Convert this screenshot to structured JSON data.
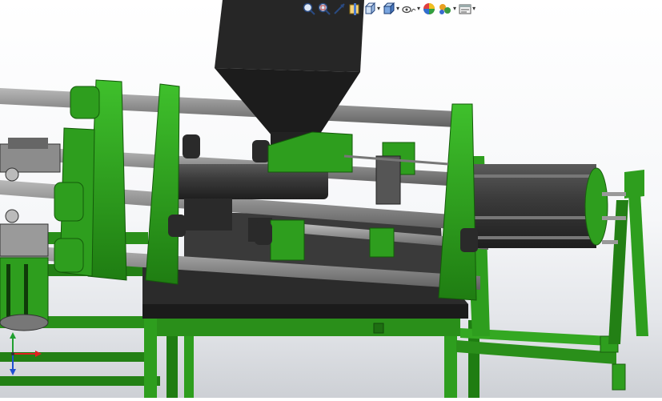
{
  "app": {
    "view": "3d-model-viewport",
    "part_color": "#2e9e1e",
    "dark_color": "#333333",
    "hopper_color": "#262626",
    "rod_color": "#8a8a8a"
  },
  "toolbar": {
    "buttons": [
      {
        "name": "zoom-to-fit-button",
        "icon": "zoom-to-fit-icon",
        "dropdown": false
      },
      {
        "name": "zoom-to-area-button",
        "icon": "zoom-to-area-icon",
        "dropdown": false
      },
      {
        "name": "previous-view-button",
        "icon": "previous-view-icon",
        "dropdown": false
      },
      {
        "name": "section-view-button",
        "icon": "section-view-icon",
        "dropdown": false
      },
      {
        "name": "view-orientation-button",
        "icon": "view-orientation-icon",
        "dropdown": true
      },
      {
        "name": "display-style-button",
        "icon": "display-style-icon",
        "dropdown": true
      },
      {
        "name": "hide-show-items-button",
        "icon": "hide-show-icon",
        "dropdown": true
      },
      {
        "name": "edit-appearance-button",
        "icon": "appearance-icon",
        "dropdown": false
      },
      {
        "name": "apply-scene-button",
        "icon": "scene-icon",
        "dropdown": true
      },
      {
        "name": "view-settings-button",
        "icon": "view-settings-icon",
        "dropdown": true
      }
    ],
    "dropdown_glyph": "▾"
  },
  "triad": {
    "x_color": "#e02020",
    "y_color": "#20a030",
    "z_color": "#2050d0"
  }
}
